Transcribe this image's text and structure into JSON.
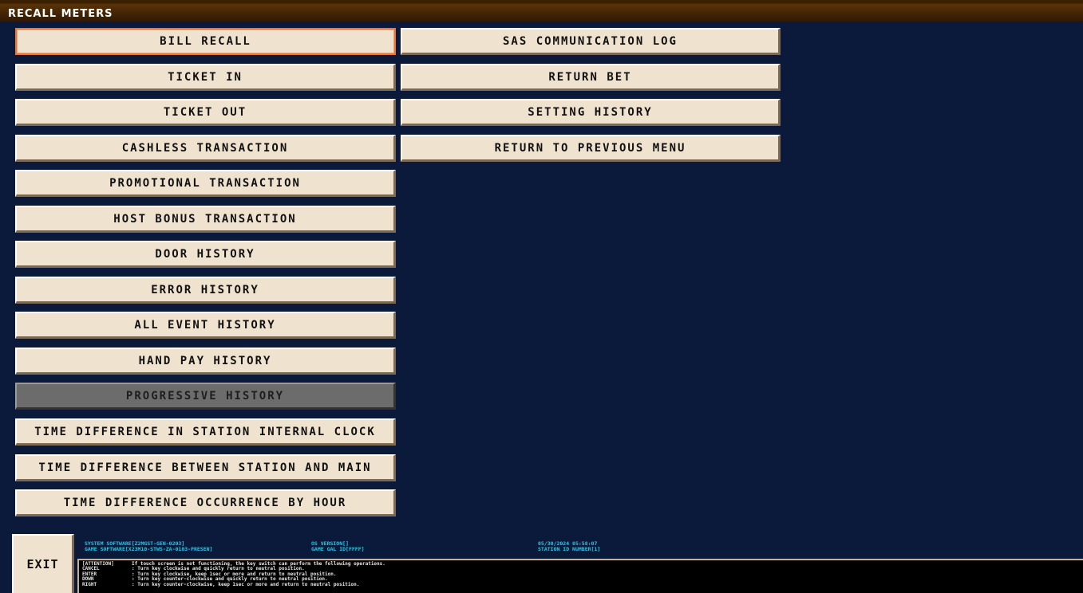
{
  "title": "RECALL METERS",
  "left_buttons": [
    {
      "label": "BILL RECALL",
      "state": "selected"
    },
    {
      "label": "TICKET IN",
      "state": "normal"
    },
    {
      "label": "TICKET OUT",
      "state": "normal"
    },
    {
      "label": "CASHLESS TRANSACTION",
      "state": "normal"
    },
    {
      "label": "PROMOTIONAL TRANSACTION",
      "state": "normal"
    },
    {
      "label": "HOST BONUS TRANSACTION",
      "state": "normal"
    },
    {
      "label": "DOOR HISTORY",
      "state": "normal"
    },
    {
      "label": "ERROR HISTORY",
      "state": "normal"
    },
    {
      "label": "ALL EVENT HISTORY",
      "state": "normal"
    },
    {
      "label": "HAND PAY HISTORY",
      "state": "normal"
    },
    {
      "label": "PROGRESSIVE HISTORY",
      "state": "disabled"
    },
    {
      "label": "TIME DIFFERENCE IN STATION INTERNAL CLOCK",
      "state": "normal"
    },
    {
      "label": "TIME DIFFERENCE BETWEEN STATION AND MAIN",
      "state": "normal"
    },
    {
      "label": "TIME DIFFERENCE OCCURRENCE BY HOUR",
      "state": "normal"
    }
  ],
  "right_buttons": [
    {
      "label": "SAS COMMUNICATION LOG"
    },
    {
      "label": "RETURN BET"
    },
    {
      "label": "SETTING HISTORY"
    },
    {
      "label": "RETURN TO PREVIOUS MENU"
    }
  ],
  "exit_label": "EXIT",
  "info": {
    "system_software": "SYSTEM SOFTWARE[Z2MGST-GEN-0203]",
    "game_software": "GAME SOFTWARE[X23M10-STWS-ZA-0103-PRESEN]",
    "os_version": "OS VERSION[]",
    "game_gal_id": "GAME GAL ID[FFFF]",
    "datetime": "05/30/2024 05:58:07",
    "station_id": "STATION ID NUMBER[1]"
  },
  "attention": [
    {
      "key": "[ATTENTION]",
      "text": "If touch screen is not functioning, the key switch can perform the following operations."
    },
    {
      "key": "CANCEL",
      "text": ": Turn key clockwise and quickly return to neutral position."
    },
    {
      "key": "ENTER",
      "text": ": Turn key clockwise, keep 1sec or more and return to neutral position."
    },
    {
      "key": "DOWN",
      "text": ": Turn key counter-clockwise and quickly return to neutral position."
    },
    {
      "key": "RIGHT",
      "text": ": Turn key counter-clockwise, keep 1sec or more and return to neutral position."
    }
  ],
  "colors": {
    "background": "#0b1a3a",
    "button": "#efe3cf",
    "selected_border": "#e8763a",
    "disabled": "#6c6c6c",
    "info_text": "#22c8e8"
  }
}
